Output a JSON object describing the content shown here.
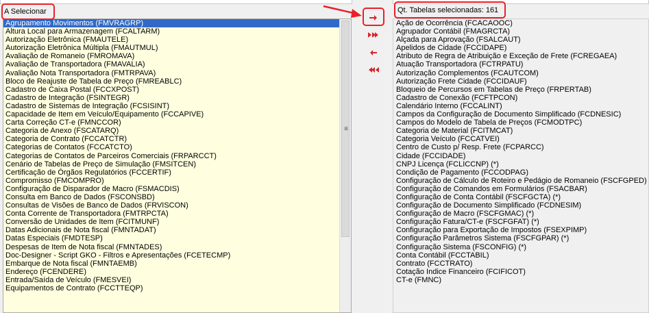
{
  "left_panel": {
    "title": "A Selecionar",
    "selected_index": 0,
    "items": [
      "Agrupamento Movimentos (FMVRAGRP)",
      "Altura Local para Armazenagem (FCALTARM)",
      "Autorização Eletrônica (FMAUTELE)",
      "Autorização Eletrônica Múltipla (FMAUTMUL)",
      "Avaliação de Romaneio (FMROMAVA)",
      "Avaliação de Transportadora (FMAVALIA)",
      "Avaliação Nota Transportadora (FMTRPAVA)",
      "Bloco de Reajuste de Tabela de Preço (FMREABLC)",
      "Cadastro de Caixa Postal (FCCXPOST)",
      "Cadastro de Integração (FSINTEGR)",
      "Cadastro de Sistemas de Integração (FCSISINT)",
      "Capacidade de Item em Veículo/Equipamento (FCCAPIVE)",
      "Carta Correção CT-e (FMNCCOR)",
      "Categoria de Anexo (FSCATARQ)",
      "Categoria de Contrato (FCCATCTR)",
      "Categorias de Contatos (FCCATCTO)",
      "Categorias de Contatos de Parceiros Comerciais (FRPARCCT)",
      "Cenário de Tabelas de Preço de Simulação (FMSITCEN)",
      "Certificação de Órgãos Regulatórios (FCCERTIF)",
      "Compromisso (FMCOMPRO)",
      "Configuração de Disparador de Macro (FSMACDIS)",
      "Consulta em Banco de Dados (FSCONSBD)",
      "Consultas de Visões de Banco de Dados (FRVISCON)",
      "Conta Corrente de Transportadora (FMTRPCTA)",
      "Conversão de Unidades de Item (FCITMUNF)",
      "Datas Adicionais de Nota fiscal (FMNTADAT)",
      "Datas Especiais (FMDTESP)",
      "Despesas de Item de Nota fiscal (FMNTADES)",
      "Doc-Designer - Script GKO - Filtros e Apresentações (FCETECMP)",
      "Embarque de Nota fiscal (FMNTAEMB)",
      "Endereço (FCENDERE)",
      "Entrada/Saída de Veículo (FMESVEI)",
      "Equipamentos de Contrato (FCCTTEQP)"
    ]
  },
  "right_panel": {
    "title": "Qt. Tabelas selecionadas: 161",
    "items": [
      "Ação de Ocorrência (FCACAOOC)",
      "Agrupador Contábil (FMAGRCTA)",
      "Alçada para Aprovação (FSALCAUT)",
      "Apelidos de Cidade (FCCIDAPE)",
      "Atributo de Regra de Atribuição e Exceção de Frete (FCREGAEA)",
      "Atuação Transportadora (FCTRPATU)",
      "Autorização Complementos (FCAUTCOM)",
      "Autorização Frete Cidade (FCCIDAUF)",
      "Bloqueio de Percursos em Tabelas de Preço (FRPERTAB)",
      "Cadastro de Conexão (FCFTPCON)",
      "Calendário Interno (FCCALINT)",
      "Campos da Configuração de Documento Simplificado (FCDNESIC)",
      "Campos do Modelo de Tabela de Preços (FCMODTPC)",
      "Categoria de Material (FCITMCAT)",
      "Categoria Veículo (FCCATVEI)",
      "Centro de Custo p/ Resp. Frete (FCPARCC)",
      "Cidade (FCCIDADE)",
      "CNPJ Licença (FCLICCNP) (*)",
      "Condição de Pagamento (FCCODPAG)",
      "Configuração de Cálculo de Roteiro e Pedágio de Romaneio (FSCFGPED)",
      "Configuração de Comandos em Formulários (FSACBAR)",
      "Configuração de Conta Contábil (FSCFGCTA) (*)",
      "Configuração de Documento Simplificado (FCDNESIM)",
      "Configuração de Macro (FSCFGMAC) (*)",
      "Configuração Fatura/CT-e (FSCFGFAT) (*)",
      "Configuração para Exportação de Impostos (FSEXPIMP)",
      "Configuração Parâmetros Sistema (FSCFGPAR) (*)",
      "Configuração Sistema (FSCONFIG) (*)",
      "Conta Contábil (FCCTABIL)",
      "Contrato (FCCTRATO)",
      "Cotação Indice Financeiro (FCIFICOT)",
      "CT-e (FMNC)"
    ]
  },
  "buttons": {
    "move_one_right": "arrow-right-icon",
    "move_all_right": "double-arrow-right-icon",
    "move_one_left": "arrow-left-icon",
    "move_all_left": "double-arrow-left-icon"
  },
  "colors": {
    "left_list_bg": "#ffffe0",
    "selection_bg": "#3169c6",
    "arrow_red": "#d4262c",
    "annotation_red": "#e8202a"
  }
}
